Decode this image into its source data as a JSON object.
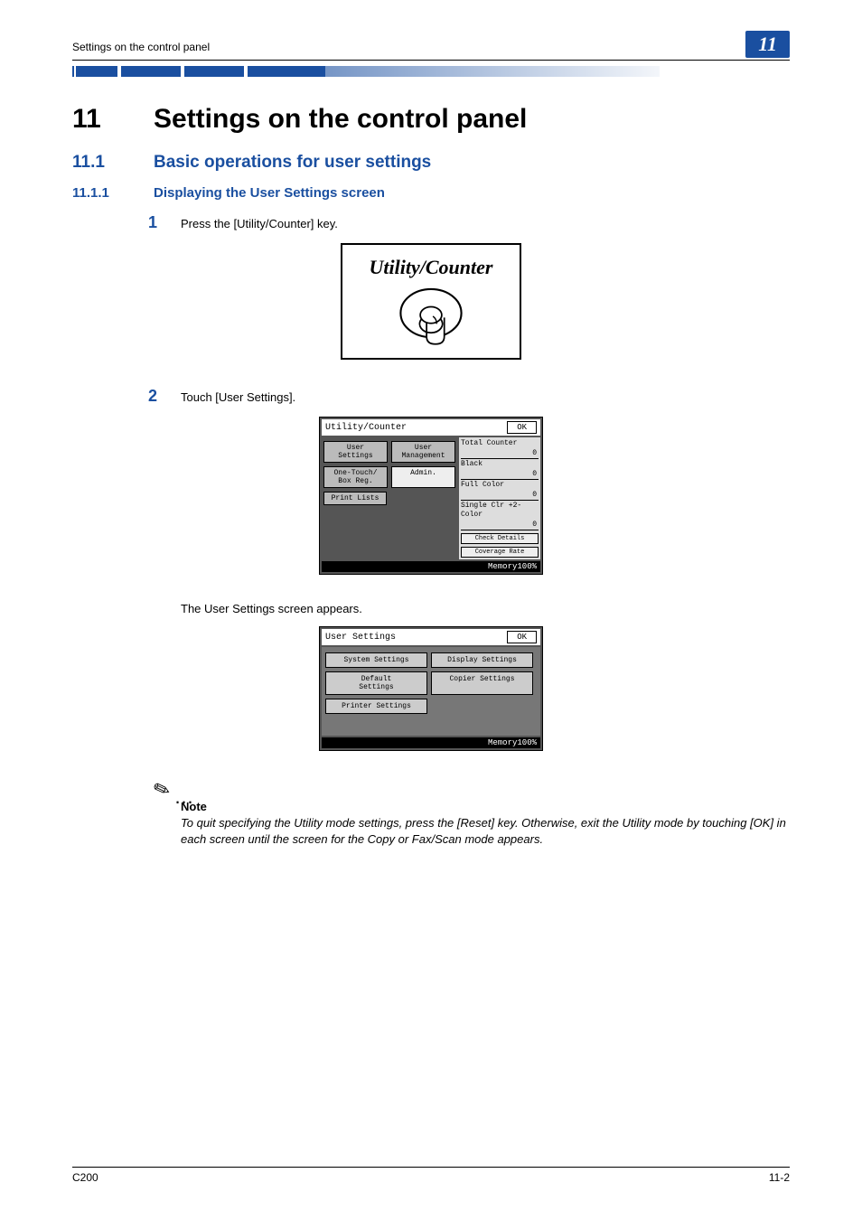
{
  "header": {
    "title": "Settings on the control panel",
    "chapter": "11"
  },
  "h1": {
    "num": "11",
    "text": "Settings on the control panel"
  },
  "h2": {
    "num": "11.1",
    "text": "Basic operations for user settings"
  },
  "h3": {
    "num": "11.1.1",
    "text": "Displaying the User Settings screen"
  },
  "steps": {
    "s1_num": "1",
    "s1_text": "Press the [Utility/Counter] key.",
    "s2_num": "2",
    "s2_text": "Touch [User Settings].",
    "after_text": "The User Settings screen appears."
  },
  "fig1": {
    "caption": "Utility/Counter"
  },
  "lcd1": {
    "title": "Utility/Counter",
    "ok": "OK",
    "user_settings": "User\nSettings",
    "user_management": "User\nManagement",
    "one_touch": "One-Touch/\nBox Reg.",
    "admin": "Admin.",
    "print_lists": "Print Lists",
    "total_counter": "Total\nCounter",
    "black": "Black",
    "full_color": "Full Color",
    "single_clr": "Single Clr\n+2-Color",
    "check_details": "Check\nDetails",
    "coverage": "Coverage\nRate",
    "val0": "0",
    "memory": "Memory100%"
  },
  "lcd2": {
    "title": "User Settings",
    "ok": "OK",
    "system": "System Settings",
    "display": "Display Settings",
    "default": "Default\nSettings",
    "copier": "Copier Settings",
    "printer": "Printer Settings",
    "memory": "Memory100%"
  },
  "note": {
    "label": "Note",
    "text": "To quit specifying the Utility mode settings, press the [Reset] key. Otherwise, exit the Utility mode by touching [OK] in each screen until the screen for the Copy or Fax/Scan mode appears."
  },
  "footer": {
    "left": "C200",
    "right": "11-2"
  }
}
